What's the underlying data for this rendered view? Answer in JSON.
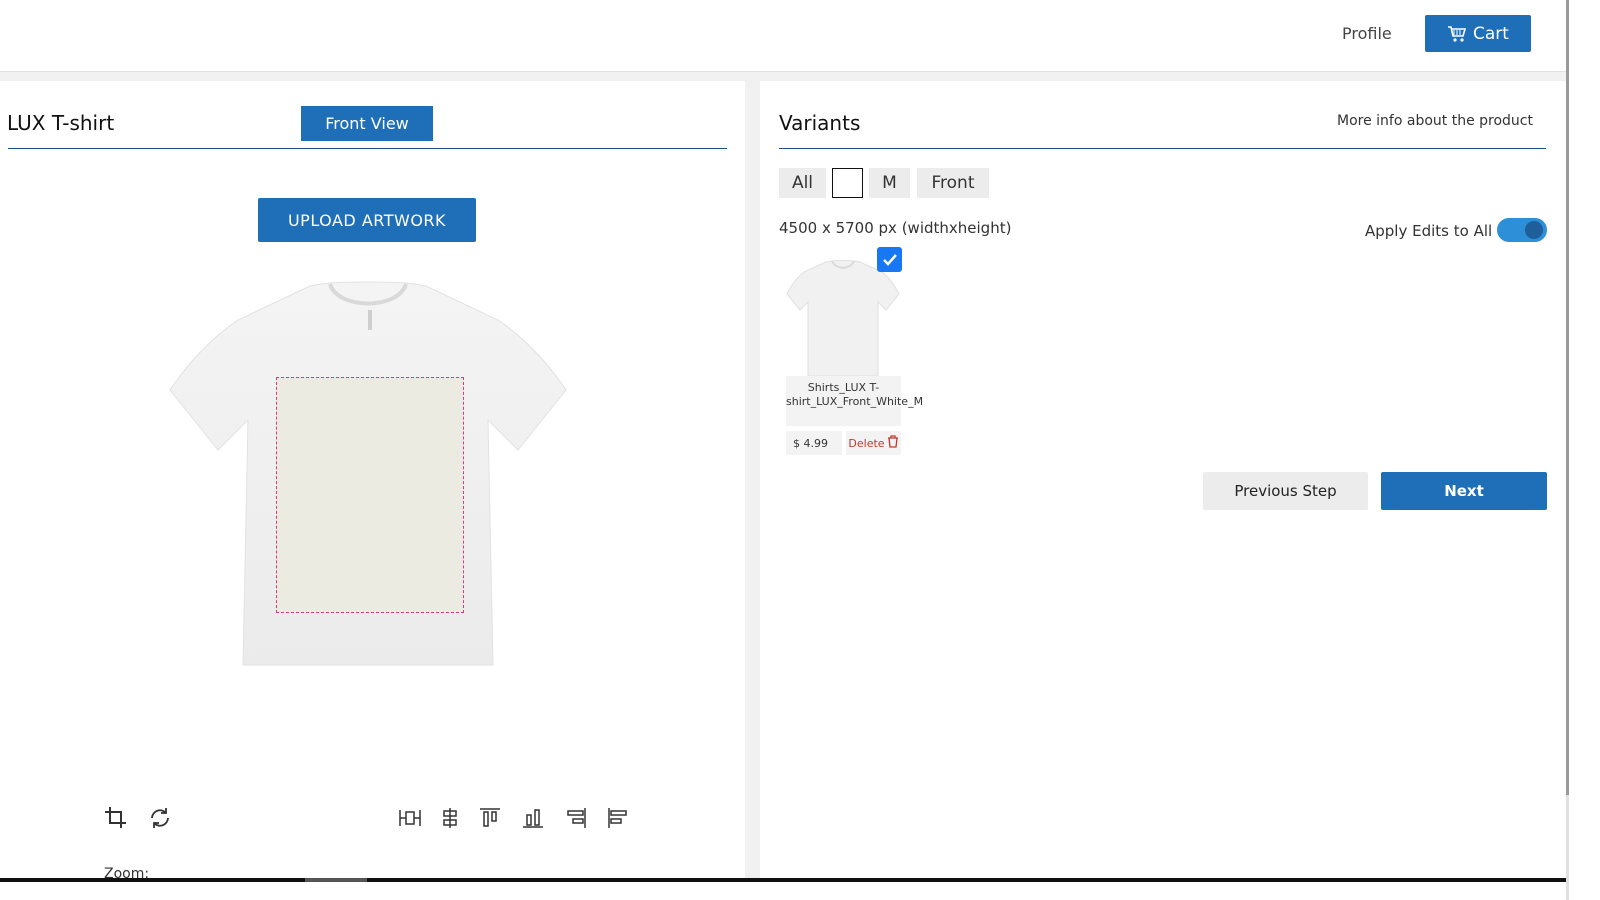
{
  "header": {
    "profile_label": "Profile",
    "cart_label": "Cart",
    "cart_icon": "cart-icon"
  },
  "left_panel": {
    "product_title": "LUX T-shirt",
    "view_button_label": "Front View",
    "upload_button_label": "UPLOAD ARTWORK",
    "zoom_label": "Zoom:",
    "tools": [
      "crop-icon",
      "rotate-icon"
    ],
    "align_tools": [
      "align-horizontal-center-icon",
      "align-vertical-center-icon",
      "align-top-icon",
      "align-bottom-icon",
      "align-right-icon",
      "align-left-icon"
    ]
  },
  "right_panel": {
    "title": "Variants",
    "more_info_label": "More info about the product",
    "filters": {
      "all": "All",
      "size": "M",
      "side": "Front",
      "color_swatch": "#ffffff"
    },
    "dimensions_text": "4500 x 5700 px (widthxheight)",
    "apply_edits_label": "Apply Edits to All",
    "apply_edits_on": true,
    "variant": {
      "name": "Shirts_LUX T-shirt_LUX_Front_White_M",
      "price": "$ 4.99",
      "delete_label": "Delete",
      "selected": true
    },
    "previous_label": "Previous Step",
    "next_label": "Next"
  },
  "colors": {
    "primary": "#1e6fb8",
    "print_area_border": "#d63a8c",
    "delete": "#c0392b"
  }
}
